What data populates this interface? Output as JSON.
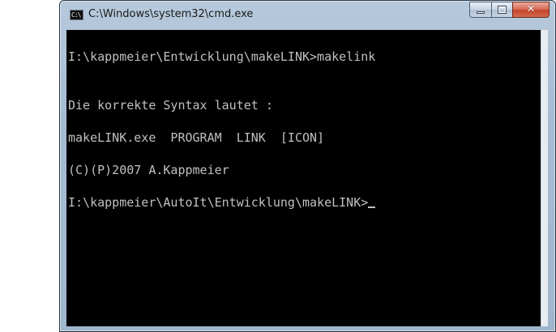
{
  "window": {
    "title": "C:\\Windows\\system32\\cmd.exe",
    "icon": "cmd-icon",
    "icon_glyph": "C:\\"
  },
  "caption_buttons": {
    "minimize_icon": "minimize-icon",
    "maximize_icon": "maximize-icon",
    "close_icon": "close-icon",
    "close_glyph": "✕"
  },
  "console": {
    "lines": [
      "I:\\kappmeier\\Entwicklung\\makeLINK>makelink",
      "Die korrekte Syntax lautet :",
      "makeLINK.exe  PROGRAM  LINK  [ICON]",
      "(C)(P)2007 A.Kappmeier",
      "I:\\kappmeier\\AutoIt\\Entwicklung\\makeLINK>"
    ],
    "text_color": "#c0c0c0",
    "background_color": "#000000"
  },
  "colors": {
    "close_button": "#c6452b",
    "frame": "#a7bdd3"
  }
}
